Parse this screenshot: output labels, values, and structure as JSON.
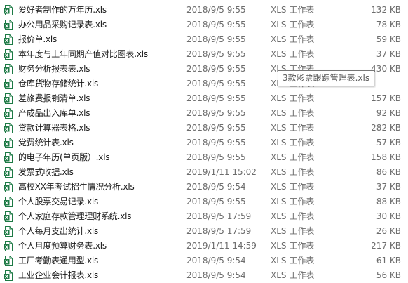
{
  "files": [
    {
      "name": "爱好者制作的万年历.xls",
      "date": "2018/9/5 9:55",
      "type": "XLS 工作表",
      "size": "132 KB"
    },
    {
      "name": "办公用品采购记录表.xls",
      "date": "2018/9/5 9:55",
      "type": "XLS 工作表",
      "size": "78 KB"
    },
    {
      "name": "报价单.xls",
      "date": "2018/9/5 9:55",
      "type": "XLS 工作表",
      "size": "59 KB"
    },
    {
      "name": "本年度与上年同期产值对比图表.xls",
      "date": "2018/9/5 9:55",
      "type": "XLS 工作表",
      "size": "37 KB"
    },
    {
      "name": "财务分析报表表.xls",
      "date": "2018/9/5 9:55",
      "type": "XLS 工作表",
      "size": "430 KB"
    },
    {
      "name": "仓库货物存储统计.xls",
      "date": "2018/9/5 9:55",
      "type": "XLS 工作表",
      "size": ""
    },
    {
      "name": "差旅费报销清单.xls",
      "date": "2018/9/5 9:55",
      "type": "XLS 工作表",
      "size": "157 KB"
    },
    {
      "name": "产成品出入库单.xls",
      "date": "2018/9/5 9:55",
      "type": "XLS 工作表",
      "size": "92 KB"
    },
    {
      "name": "贷款计算器表格.xls",
      "date": "2018/9/5 9:55",
      "type": "XLS 工作表",
      "size": "282 KB"
    },
    {
      "name": "党费统计表.xls",
      "date": "2018/9/5 9:55",
      "type": "XLS 工作表",
      "size": "57 KB"
    },
    {
      "name": "的电子年历(单页版）.xls",
      "date": "2018/9/5 9:55",
      "type": "XLS 工作表",
      "size": "158 KB"
    },
    {
      "name": "发票式收据.xls",
      "date": "2019/1/11 15:02",
      "type": "XLS 工作表",
      "size": "86 KB"
    },
    {
      "name": "高校XX年考试招生情况分析.xls",
      "date": "2018/9/5 9:54",
      "type": "XLS 工作表",
      "size": "37 KB"
    },
    {
      "name": "个人股票交易记录.xls",
      "date": "2018/9/5 9:55",
      "type": "XLS 工作表",
      "size": "88 KB"
    },
    {
      "name": "个人家庭存款管理理财系统.xls",
      "date": "2018/9/5 17:59",
      "type": "XLS 工作表",
      "size": "30 KB"
    },
    {
      "name": "个人每月支出统计.xls",
      "date": "2018/9/5 17:59",
      "type": "XLS 工作表",
      "size": "26 KB"
    },
    {
      "name": "个人月度预算财务表.xls",
      "date": "2019/1/11 14:59",
      "type": "XLS 工作表",
      "size": "217 KB"
    },
    {
      "name": "工厂考勤表通用型.xls",
      "date": "2018/9/5 9:54",
      "type": "XLS 工作表",
      "size": "61 KB"
    },
    {
      "name": "工业企业会计报表.xls",
      "date": "2018/9/5 9:54",
      "type": "XLS 工作表",
      "size": "56 KB"
    }
  ],
  "tooltip": {
    "text": "3款彩票跟踪管理表.xls"
  },
  "colors": {
    "icon_green": "#1d7a45",
    "text": "#1a1a1a",
    "meta_text": "#6d6d6d"
  }
}
